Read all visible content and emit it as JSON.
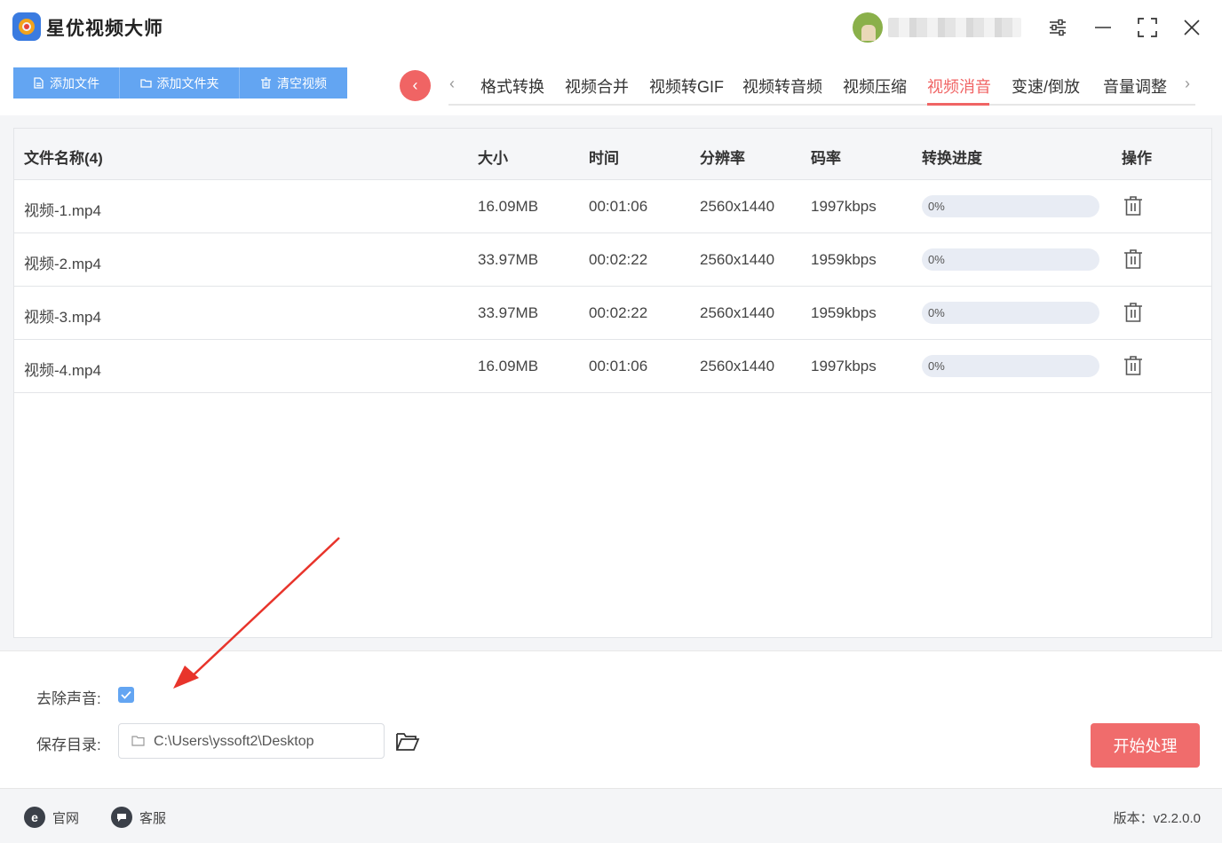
{
  "app": {
    "title": "星优视频大师"
  },
  "toolbar": {
    "add_file": "添加文件",
    "add_folder": "添加文件夹",
    "clear": "清空视频"
  },
  "tabs": {
    "back_icon": "chevron-left-icon",
    "prev": "‹",
    "next": "›",
    "items": [
      "格式转换",
      "视频合并",
      "视频转GIF",
      "视频转音频",
      "视频压缩",
      "视频消音",
      "变速/倒放",
      "音量调整"
    ],
    "active": "视频消音"
  },
  "table": {
    "headers": {
      "name": "文件名称(4)",
      "size": "大小",
      "time": "时间",
      "resolution": "分辨率",
      "bitrate": "码率",
      "progress": "转换进度",
      "action": "操作"
    },
    "rows": [
      {
        "name": "视频-1.mp4",
        "size": "16.09MB",
        "time": "00:01:06",
        "resolution": "2560x1440",
        "bitrate": "1997kbps",
        "progress": "0%",
        "progress_value": 0
      },
      {
        "name": "视频-2.mp4",
        "size": "33.97MB",
        "time": "00:02:22",
        "resolution": "2560x1440",
        "bitrate": "1959kbps",
        "progress": "0%",
        "progress_value": 0
      },
      {
        "name": "视频-3.mp4",
        "size": "33.97MB",
        "time": "00:02:22",
        "resolution": "2560x1440",
        "bitrate": "1959kbps",
        "progress": "0%",
        "progress_value": 0
      },
      {
        "name": "视频-4.mp4",
        "size": "16.09MB",
        "time": "00:01:06",
        "resolution": "2560x1440",
        "bitrate": "1997kbps",
        "progress": "0%",
        "progress_value": 0
      }
    ]
  },
  "settings": {
    "remove_audio_label": "去除声音:",
    "remove_audio_checked": true,
    "save_dir_label": "保存目录:",
    "save_dir_value": "C:\\Users\\yssoft2\\Desktop"
  },
  "actions": {
    "start": "开始处理"
  },
  "footer": {
    "website": "官网",
    "support": "客服",
    "version": "版本：v2.2.0.0"
  },
  "colors": {
    "accent_blue": "#63a5f2",
    "accent_red": "#f06464",
    "start_button": "#f06c6c",
    "annotation_arrow": "#e8342b"
  }
}
